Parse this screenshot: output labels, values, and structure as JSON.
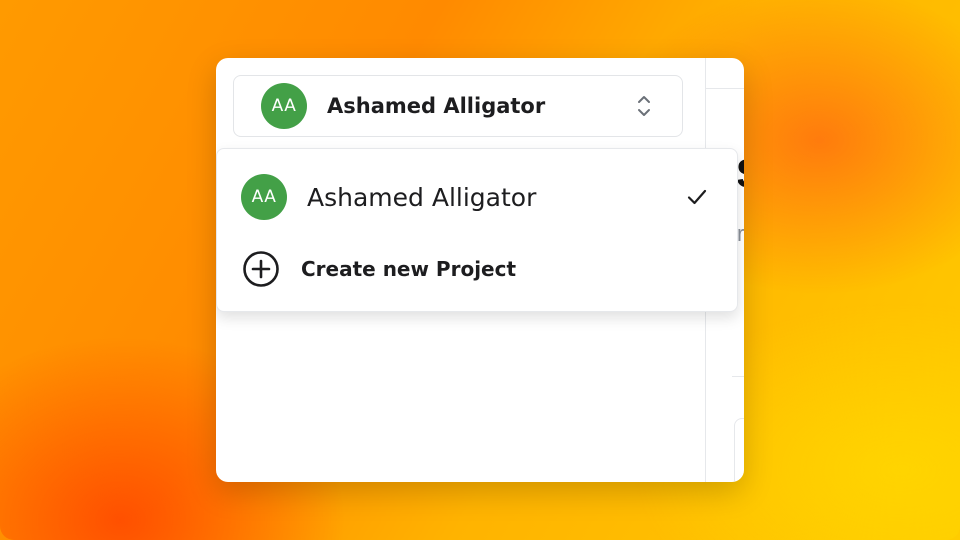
{
  "project_switcher": {
    "current": {
      "initials": "AA",
      "name": "Ashamed Alligator",
      "avatar_color": "#43a047"
    },
    "chevron_icon": "chevron-up-down-icon"
  },
  "dropdown": {
    "items": [
      {
        "initials": "AA",
        "name": "Ashamed Alligator",
        "selected": true,
        "icon": "check-icon"
      }
    ],
    "create": {
      "label": "Create new Project",
      "icon": "plus-circle-icon"
    }
  },
  "background_page": {
    "heading_fragment": "S",
    "subtext_fragment": "r"
  }
}
